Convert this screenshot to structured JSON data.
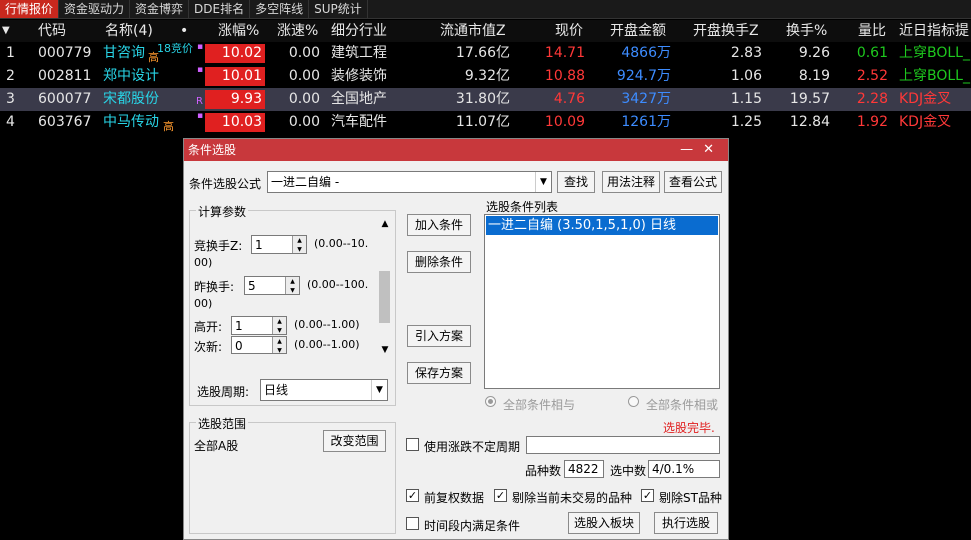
{
  "tabs": [
    "行情报价",
    "资金驱动力",
    "资金博弈",
    "DDE排名",
    "多空阵线",
    "SUP统计"
  ],
  "table": {
    "headers": [
      "代码",
      "名称(4)",
      "•",
      "涨幅%",
      "涨速%",
      "细分行业",
      "流通市值Z",
      "现价",
      "开盘金额",
      "开盘换手Z",
      "换手%",
      "量比",
      "近日指标提"
    ],
    "rows": [
      {
        "idx": "1",
        "code": "000779",
        "name": "甘咨询",
        "tag": "高",
        "extra": "18竞价",
        "mark": "▪",
        "chg": "10.02",
        "speed": "0.00",
        "industry": "建筑工程",
        "mcap": "17.66亿",
        "price": "14.71",
        "open_amt": "4866万",
        "open_turn": "2.83",
        "turn": "9.26",
        "vol_ratio": "0.61",
        "indicator": "上穿BOLL_"
      },
      {
        "idx": "2",
        "code": "002811",
        "name": "郑中设计",
        "tag": "",
        "extra": "",
        "mark": "▪",
        "chg": "10.01",
        "speed": "0.00",
        "industry": "装修装饰",
        "mcap": "9.32亿",
        "price": "10.88",
        "open_amt": "924.7万",
        "open_turn": "1.06",
        "turn": "8.19",
        "vol_ratio": "2.52",
        "indicator": "上穿BOLL_"
      },
      {
        "idx": "3",
        "code": "600077",
        "name": "宋都股份",
        "tag": "",
        "extra": "",
        "mark": "R",
        "chg": "9.93",
        "speed": "0.00",
        "industry": "全国地产",
        "mcap": "31.80亿",
        "price": "4.76",
        "open_amt": "3427万",
        "open_turn": "1.15",
        "turn": "19.57",
        "vol_ratio": "2.28",
        "indicator": "KDJ金叉"
      },
      {
        "idx": "4",
        "code": "603767",
        "name": "中马传动",
        "tag": "高",
        "extra": "",
        "mark": "▪",
        "chg": "10.03",
        "speed": "0.00",
        "industry": "汽车配件",
        "mcap": "11.07亿",
        "price": "10.09",
        "open_amt": "1261万",
        "open_turn": "1.25",
        "turn": "12.84",
        "vol_ratio": "1.92",
        "indicator": "KDJ金叉"
      }
    ]
  },
  "dialog": {
    "title": "条件选股",
    "formula_label": "条件选股公式",
    "formula_value": "一进二自编   -",
    "find_btn": "查找",
    "usage_btn": "用法注释",
    "view_btn": "查看公式",
    "params_title": "计算参数",
    "params": [
      {
        "label": "竞换手Z:",
        "value": "1",
        "range": "(0.00--10.",
        "range2": "00)"
      },
      {
        "label": "昨换手:",
        "value": "5",
        "range": "(0.00--100.",
        "range2": "00)"
      },
      {
        "label": "高开:",
        "value": "1",
        "range": "(0.00--1.00)",
        "range2": ""
      },
      {
        "label": "次新:",
        "value": "0",
        "range": "(0.00--1.00)",
        "range2": ""
      }
    ],
    "period_label": "选股周期:",
    "period_value": "日线",
    "add_btn": "加入条件",
    "del_btn": "删除条件",
    "import_btn": "引入方案",
    "save_btn": "保存方案",
    "list_title": "选股条件列表",
    "list_items": [
      "一进二自编 (3.50,1,5,1,0) 日线"
    ],
    "radio_and": "全部条件相与",
    "radio_or": "全部条件相或",
    "status": "选股完毕.",
    "scope_title": "选股范围",
    "scope_value": "全部A股",
    "change_scope_btn": "改变范围",
    "uncertain_period": "使用涨跌不定周期",
    "count_label": "品种数",
    "count_value": "4822",
    "selected_label": "选中数",
    "selected_value": "4/0.1%",
    "forward_adj": "前复权数据",
    "exclude_untraded": "剔除当前未交易的品种",
    "exclude_st": "剔除ST品种",
    "time_range": "时间段内满足条件",
    "to_block_btn": "选股入板块",
    "run_btn": "执行选股",
    "check": "✓"
  }
}
